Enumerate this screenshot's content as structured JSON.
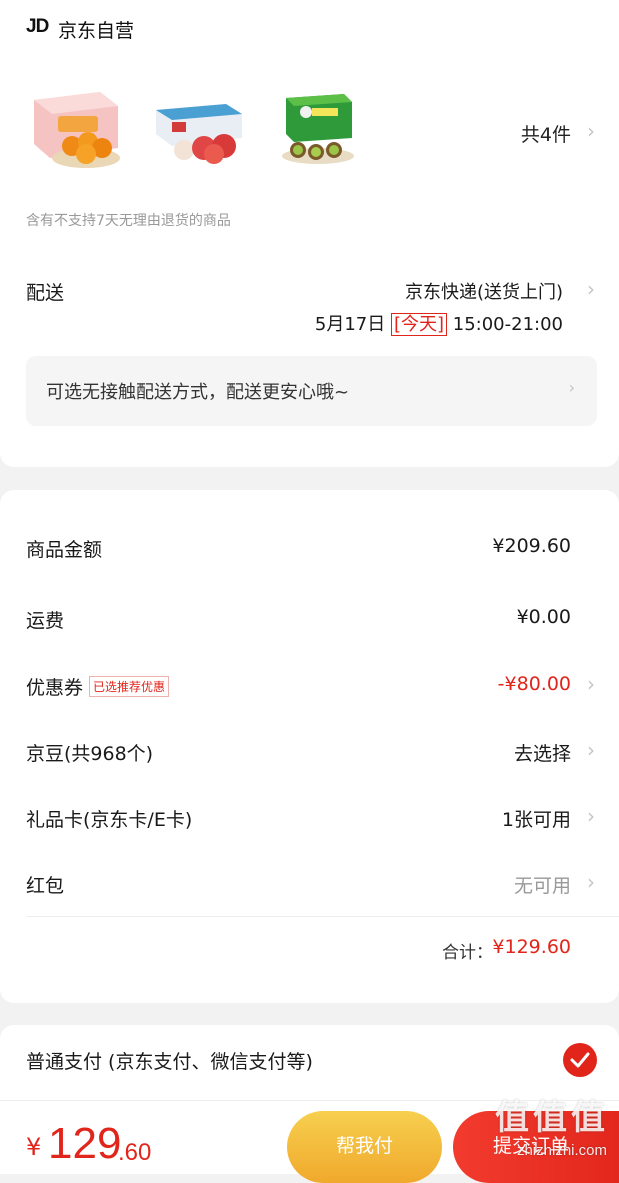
{
  "shop": {
    "logo_text": "JD",
    "name": "京东自营"
  },
  "products": {
    "items": [
      {
        "icon": "orange-gift-box"
      },
      {
        "icon": "apple-gift-box"
      },
      {
        "icon": "kiwi-gift-box"
      }
    ],
    "count_label": "共4件"
  },
  "notice": "含有不支持7天无理由退货的商品",
  "delivery": {
    "label": "配送",
    "method": "京东快递(送货上门)",
    "date": "5月17日",
    "today_badge": "[今天]",
    "time_range": "15:00-21:00",
    "contactless_text": "可选无接触配送方式，配送更安心哦~"
  },
  "price_rows": {
    "goods": {
      "label": "商品金额",
      "value": "¥209.60"
    },
    "shipping": {
      "label": "运费",
      "value": "¥0.00"
    },
    "coupon": {
      "label": "优惠券",
      "tag": "已选推荐优惠",
      "value": "-¥80.00"
    },
    "jingdou": {
      "label": "京豆(共968个)",
      "value": "去选择"
    },
    "giftcard": {
      "label": "礼品卡(京东卡/E卡)",
      "value": "1张可用"
    },
    "redpacket": {
      "label": "红包",
      "value": "无可用"
    }
  },
  "total": {
    "label": "合计：",
    "value": "¥129.60"
  },
  "payment": {
    "label": "普通支付 (京东支付、微信支付等)",
    "selected": true
  },
  "bottom": {
    "currency": "¥",
    "price_int": "129",
    "price_dec": ".60",
    "help_pay_label": "帮我付",
    "submit_label": "提交订单"
  },
  "watermark": {
    "main": "值值值",
    "sub": "zhizhizhi.com"
  },
  "colors": {
    "accent_red": "#e1251b",
    "help_yellow": "#f0a92c",
    "background": "#f2f2f2"
  }
}
